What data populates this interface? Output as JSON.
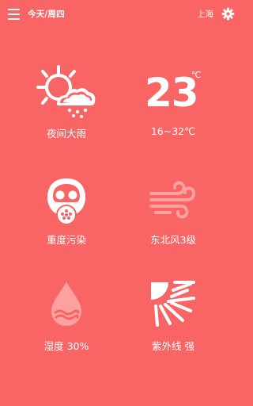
{
  "header": {
    "date": "今天/周四",
    "city": "上海"
  },
  "weather": {
    "condition": "夜间大雨"
  },
  "temperature": {
    "current": "23",
    "unit": "℃",
    "range": "16~32℃"
  },
  "pollution": {
    "label": "重度污染"
  },
  "wind": {
    "label": "东北风3级"
  },
  "humidity": {
    "label": "湿度 30%"
  },
  "uv": {
    "label": "紫外线  强"
  },
  "icons": {
    "menu": "menu-icon",
    "settings": "gear-icon",
    "weather": "sun-cloud-rain-icon",
    "pollution": "gas-mask-icon",
    "wind": "wind-icon",
    "humidity": "water-drop-icon",
    "uv": "sun-rays-icon"
  },
  "colors": {
    "background": "#f96464",
    "foreground": "#ffffff",
    "faded": "#fda0a0"
  }
}
